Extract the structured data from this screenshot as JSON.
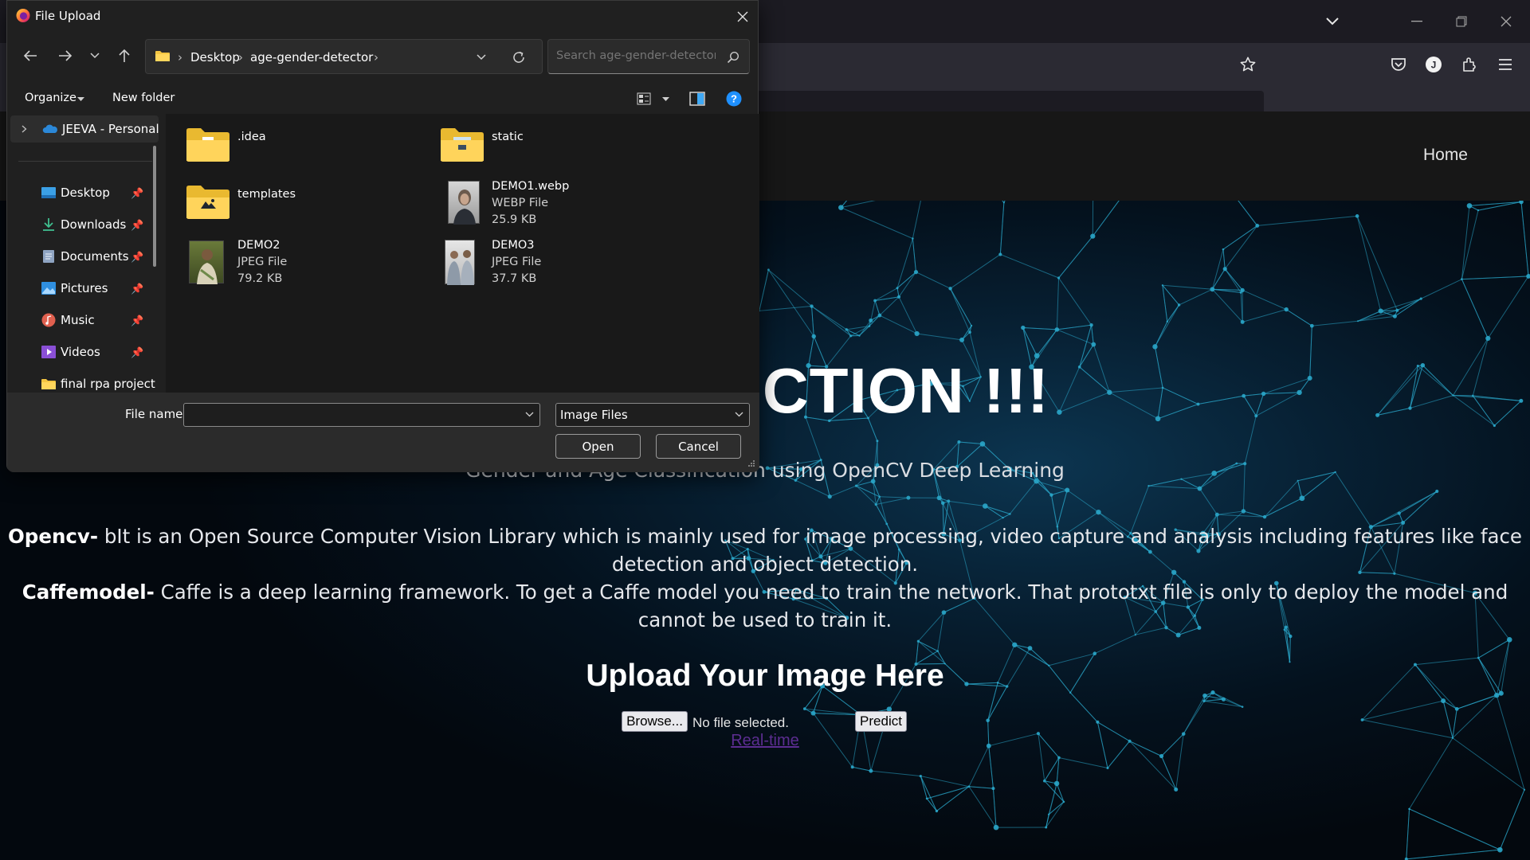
{
  "dialog": {
    "title": "File Upload",
    "breadcrumb": [
      "Desktop",
      "age-gender-detector"
    ],
    "search_placeholder": "Search age-gender-detector",
    "organize_label": "Organize",
    "new_folder_label": "New folder",
    "nav_items": [
      {
        "label": "JEEVA - Personal",
        "icon": "onedrive-icon"
      },
      {
        "label": "Desktop",
        "icon": "desktop-icon"
      },
      {
        "label": "Downloads",
        "icon": "download-icon"
      },
      {
        "label": "Documents",
        "icon": "documents-icon"
      },
      {
        "label": "Pictures",
        "icon": "pictures-icon"
      },
      {
        "label": "Music",
        "icon": "music-icon"
      },
      {
        "label": "Videos",
        "icon": "videos-icon"
      },
      {
        "label": "final rpa project",
        "icon": "folder-icon"
      }
    ],
    "files": [
      {
        "name": ".idea",
        "type": "",
        "size": ""
      },
      {
        "name": "static",
        "type": "",
        "size": ""
      },
      {
        "name": "templates",
        "type": "",
        "size": ""
      },
      {
        "name": "DEMO1.webp",
        "type": "WEBP File",
        "size": "25.9 KB"
      },
      {
        "name": "DEMO2",
        "type": "JPEG File",
        "size": "79.2 KB"
      },
      {
        "name": "DEMO3",
        "type": "JPEG File",
        "size": "37.7 KB"
      }
    ],
    "file_name_label": "File name:",
    "file_name_value": "",
    "file_type": "Image Files",
    "open_label": "Open",
    "cancel_label": "Cancel"
  },
  "site": {
    "home_link": "Home",
    "title": "ER DETECTION !!!",
    "subtitle": "Gender and Age Classification using OpenCV Deep Learning",
    "opencv_term": "Opencv-",
    "opencv_text": " bIt is an Open Source Computer Vision Library which is mainly used for image processing, video capture and analysis including features like face detection and object detection.",
    "caffe_term": "Caffemodel-",
    "caffe_text": " Caffe is a deep learning framework. To get a Caffe model you need to train the network. That prototxt file is only to deploy the model and cannot be used to train it.",
    "upload_heading": "Upload Your Image Here",
    "browse_label": "Browse...",
    "no_file_text": "No file selected.",
    "predict_label": "Predict",
    "realtime_link": "Real-time"
  },
  "colors": {
    "dialog_bg": "#202020",
    "accent_blue": "#0078d4",
    "link_purple": "#5c2d91",
    "mesh_cyan": "#2aa6c9"
  }
}
